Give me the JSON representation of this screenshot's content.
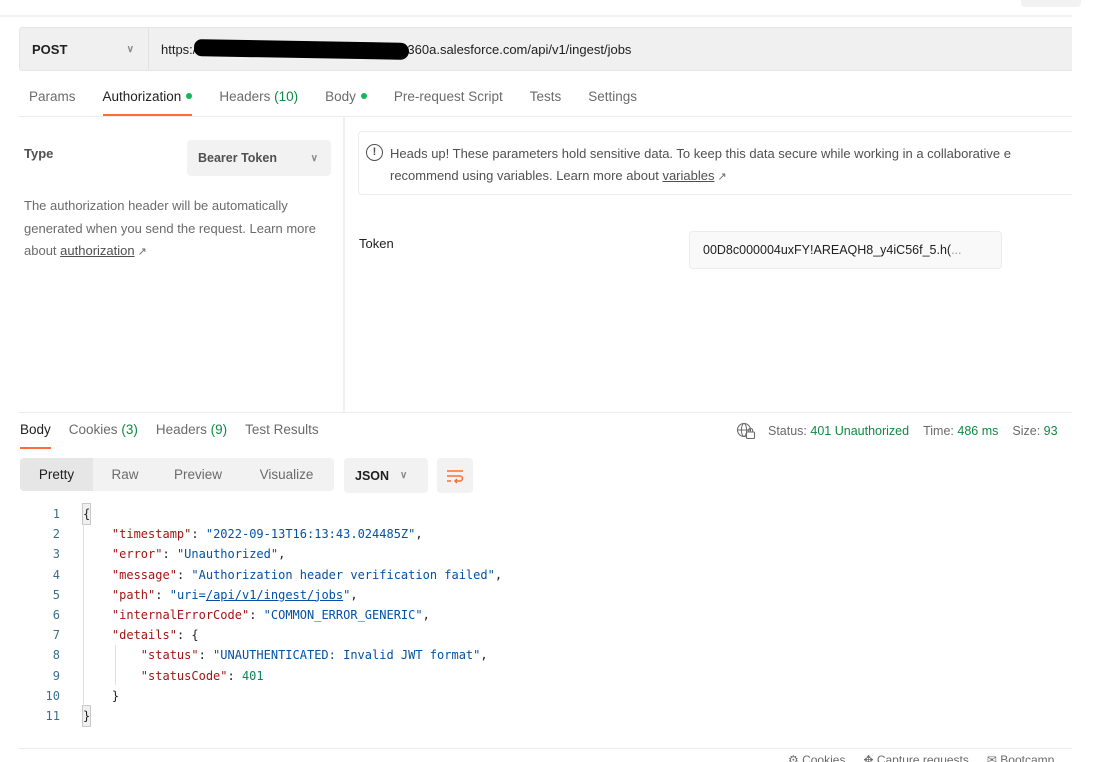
{
  "request": {
    "method": "POST",
    "url_prefix": "https:/",
    "url_suffix": "360a.salesforce.com/api/v1/ingest/jobs"
  },
  "request_tabs": [
    {
      "label": "Params",
      "count": null,
      "dot": false,
      "active": false
    },
    {
      "label": "Authorization",
      "count": null,
      "dot": true,
      "active": true
    },
    {
      "label": "Headers",
      "count": "(10)",
      "dot": false,
      "active": false
    },
    {
      "label": "Body",
      "count": null,
      "dot": true,
      "active": false
    },
    {
      "label": "Pre-request Script",
      "count": null,
      "dot": false,
      "active": false
    },
    {
      "label": "Tests",
      "count": null,
      "dot": false,
      "active": false
    },
    {
      "label": "Settings",
      "count": null,
      "dot": false,
      "active": false
    }
  ],
  "auth": {
    "type_label": "Type",
    "type_value": "Bearer Token",
    "description": "The authorization header will be automatically generated when you send the request. Learn more about ",
    "description_link": "authorization",
    "warning_text": "Heads up! These parameters hold sensitive data. To keep this data secure while working in a collaborative e",
    "warning_text_2": "recommend using variables. Learn more about ",
    "warning_link": "variables",
    "token_label": "Token",
    "token_value": "00D8c000004uxFY!AREAQH8_y4iC56f_5.h(",
    "token_ellipsis": "..."
  },
  "response_tabs": [
    {
      "label": "Body",
      "count": null,
      "active": true
    },
    {
      "label": "Cookies",
      "count": "(3)",
      "active": false
    },
    {
      "label": "Headers",
      "count": "(9)",
      "active": false
    },
    {
      "label": "Test Results",
      "count": null,
      "active": false
    }
  ],
  "response_meta": {
    "status_label": "Status:",
    "status_value": "401 Unauthorized",
    "time_label": "Time:",
    "time_value": "486 ms",
    "size_label": "Size:",
    "size_value": "93"
  },
  "view_modes": [
    "Pretty",
    "Raw",
    "Preview",
    "Visualize"
  ],
  "active_view": "Pretty",
  "format": "JSON",
  "response_body": {
    "timestamp": "2022-09-13T16:13:43.024485Z",
    "error": "Unauthorized",
    "message": "Authorization header verification failed",
    "path_prefix": "uri=",
    "path_link": "/api/v1/ingest/jobs",
    "internalErrorCode": "COMMON_ERROR_GENERIC",
    "details_status": "UNAUTHENTICATED: Invalid JWT format",
    "details_statusCode": "401"
  },
  "line_numbers": [
    "1",
    "2",
    "3",
    "4",
    "5",
    "6",
    "7",
    "8",
    "9",
    "10",
    "11"
  ],
  "status_bar": {
    "cookies": "Cookies",
    "capture": "Capture requests",
    "bootcamp": "Bootcamp"
  },
  "colors": {
    "accent": "#ff6c37",
    "success": "#0f8a43",
    "dot": "#0cbb52"
  }
}
